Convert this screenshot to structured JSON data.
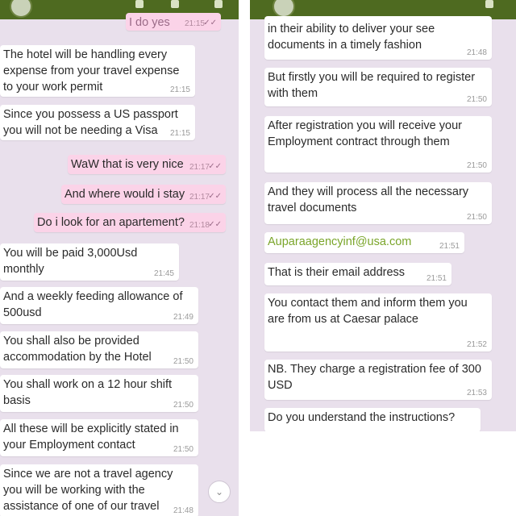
{
  "left_panel": {
    "messages": [
      {
        "dir": "out",
        "text": "",
        "time": "21:15",
        "cut": true
      },
      {
        "dir": "in",
        "text": "The hotel will be handling every expense from your travel expense to your work permit",
        "time": "21:15"
      },
      {
        "dir": "in",
        "text": "Since you possess a US passport you will not be needing a Visa",
        "time": "21:15"
      },
      {
        "dir": "out",
        "text": "WaW that is very nice",
        "time": "21:17"
      },
      {
        "dir": "out",
        "text": "And where would i stay",
        "time": "21:17"
      },
      {
        "dir": "out",
        "text": "Do i look for an apartement?",
        "time": "21:18"
      },
      {
        "dir": "in",
        "text": "You will be paid 3,000Usd monthly",
        "time": "21:45"
      },
      {
        "dir": "in",
        "text": "And a weekly feeding allowance of 500usd",
        "time": "21:49"
      },
      {
        "dir": "in",
        "text": "You shall also be provided accommodation by the Hotel",
        "time": "21:50"
      },
      {
        "dir": "in",
        "text": "You shall work on a 12 hour shift basis",
        "time": "21:50"
      },
      {
        "dir": "in",
        "text": "All these will be explicitly stated in your Employment contact",
        "time": "21:50"
      },
      {
        "dir": "in",
        "text": "Since we are not a travel agency you will be working with the assistance of one of our travel agencies",
        "time": "21:48"
      }
    ],
    "scroll_icon": "chevron-down-icon"
  },
  "right_panel": {
    "messages": [
      {
        "dir": "in",
        "text": "in their ability to deliver your see documents in a timely fashion",
        "time": "21:48"
      },
      {
        "dir": "in",
        "text": "But firstly you will be required to register with them",
        "time": "21:50"
      },
      {
        "dir": "in",
        "text": "After registration you will receive your Employment contract through them",
        "time": "21:50"
      },
      {
        "dir": "in",
        "text": "And they will process all the necessary travel documents",
        "time": "21:50"
      },
      {
        "dir": "in",
        "text": "Auparaagencyinf@usa.com",
        "time": "21:51",
        "link": true
      },
      {
        "dir": "in",
        "text": "That is their email address",
        "time": "21:51"
      },
      {
        "dir": "in",
        "text": "You contact them and inform them you are from us at Caesar palace",
        "time": "21:52"
      },
      {
        "dir": "in",
        "text": "NB. They charge a registration fee of 300 USD",
        "time": "21:53"
      },
      {
        "dir": "in",
        "text": "Do you understand the instructions?",
        "time": ""
      }
    ]
  },
  "colors": {
    "header": "#4e6a20",
    "chat_background": "#e9e0ec",
    "incoming_bubble": "#ffffff",
    "outgoing_bubble": "#fbd3e8",
    "link": "#7aa52a"
  }
}
